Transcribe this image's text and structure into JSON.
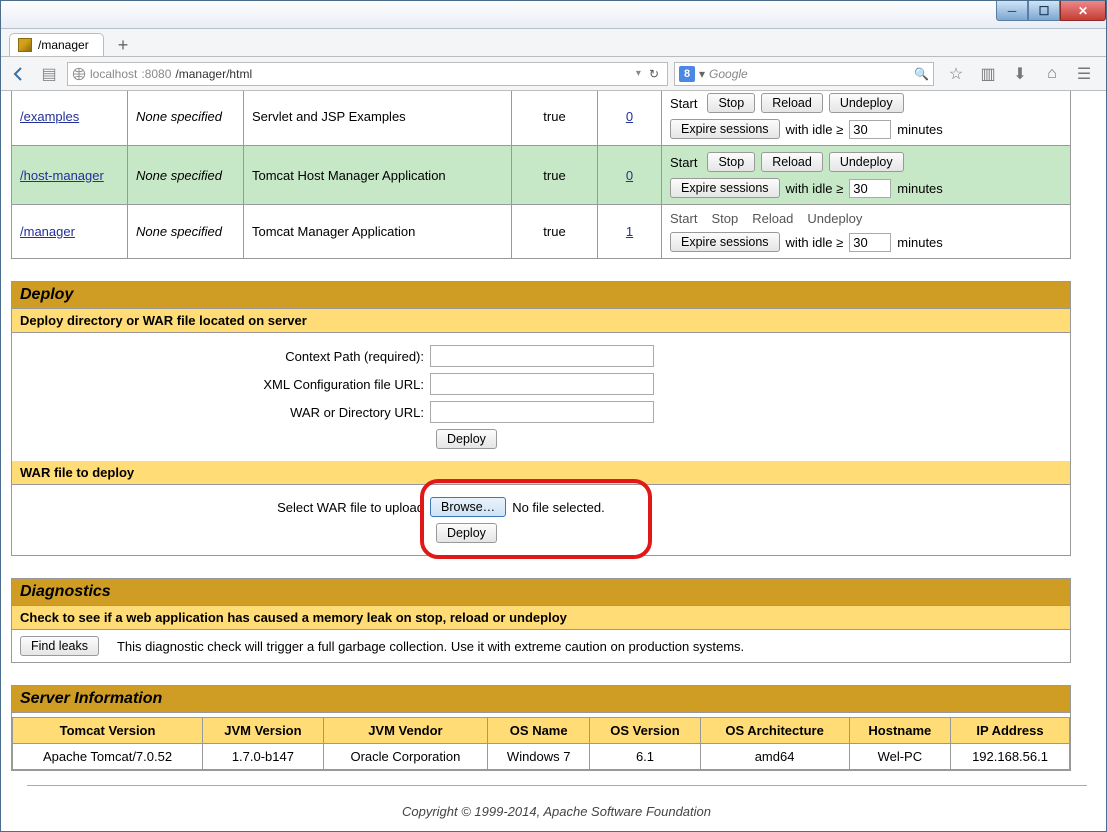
{
  "window": {
    "tab_title": "/manager"
  },
  "url": {
    "host": "localhost",
    "port": ":8080",
    "path": "/manager/html"
  },
  "search": {
    "placeholder": "Google"
  },
  "apps": [
    {
      "path": "/examples",
      "version": "None specified",
      "name": "Servlet and JSP Examples",
      "running": "true",
      "sessions": "0",
      "row": "odd",
      "cmd_start_plain": true,
      "cmd_stop_reload_undeploy_btn": false,
      "partial_top": true,
      "start": "Start",
      "stop": "Stop",
      "reload": "Reload",
      "undeploy": "Undeploy",
      "expire": "Expire sessions",
      "idle_label": "with idle ≥",
      "idle_value": "30",
      "idle_unit": "minutes"
    },
    {
      "path": "/host-manager",
      "version": "None specified",
      "name": "Tomcat Host Manager Application",
      "running": "true",
      "sessions": "0",
      "row": "even",
      "cmd_start_plain": true,
      "cmd_stop_reload_undeploy_btn": true,
      "partial_top": false,
      "start": "Start",
      "stop": "Stop",
      "reload": "Reload",
      "undeploy": "Undeploy",
      "expire": "Expire sessions",
      "idle_label": "with idle ≥",
      "idle_value": "30",
      "idle_unit": "minutes"
    },
    {
      "path": "/manager",
      "version": "None specified",
      "name": "Tomcat Manager Application",
      "running": "true",
      "sessions": "1",
      "row": "odd",
      "cmd_start_plain": true,
      "cmd_stop_reload_undeploy_btn": false,
      "all_plain": true,
      "partial_top": false,
      "start": "Start",
      "stop": "Stop",
      "reload": "Reload",
      "undeploy": "Undeploy",
      "expire": "Expire sessions",
      "idle_label": "with idle ≥",
      "idle_value": "30",
      "idle_unit": "minutes"
    }
  ],
  "deploy": {
    "hdr": "Deploy",
    "sub1": "Deploy directory or WAR file located on server",
    "ctx_label": "Context Path (required):",
    "xml_label": "XML Configuration file URL:",
    "war_label": "WAR or Directory URL:",
    "deploy_btn": "Deploy",
    "sub2": "WAR file to deploy",
    "select_label": "Select WAR file to upload",
    "browse_btn": "Browse…",
    "no_file": "No file selected."
  },
  "diag": {
    "hdr": "Diagnostics",
    "sub": "Check to see if a web application has caused a memory leak on stop, reload or undeploy",
    "btn": "Find leaks",
    "desc": "This diagnostic check will trigger a full garbage collection. Use it with extreme caution on production systems."
  },
  "server": {
    "hdr": "Server Information",
    "cols": [
      "Tomcat Version",
      "JVM Version",
      "JVM Vendor",
      "OS Name",
      "OS Version",
      "OS Architecture",
      "Hostname",
      "IP Address"
    ],
    "row": [
      "Apache Tomcat/7.0.52",
      "1.7.0-b147",
      "Oracle Corporation",
      "Windows 7",
      "6.1",
      "amd64",
      "Wel-PC",
      "192.168.56.1"
    ]
  },
  "footer": "Copyright © 1999-2014, Apache Software Foundation"
}
